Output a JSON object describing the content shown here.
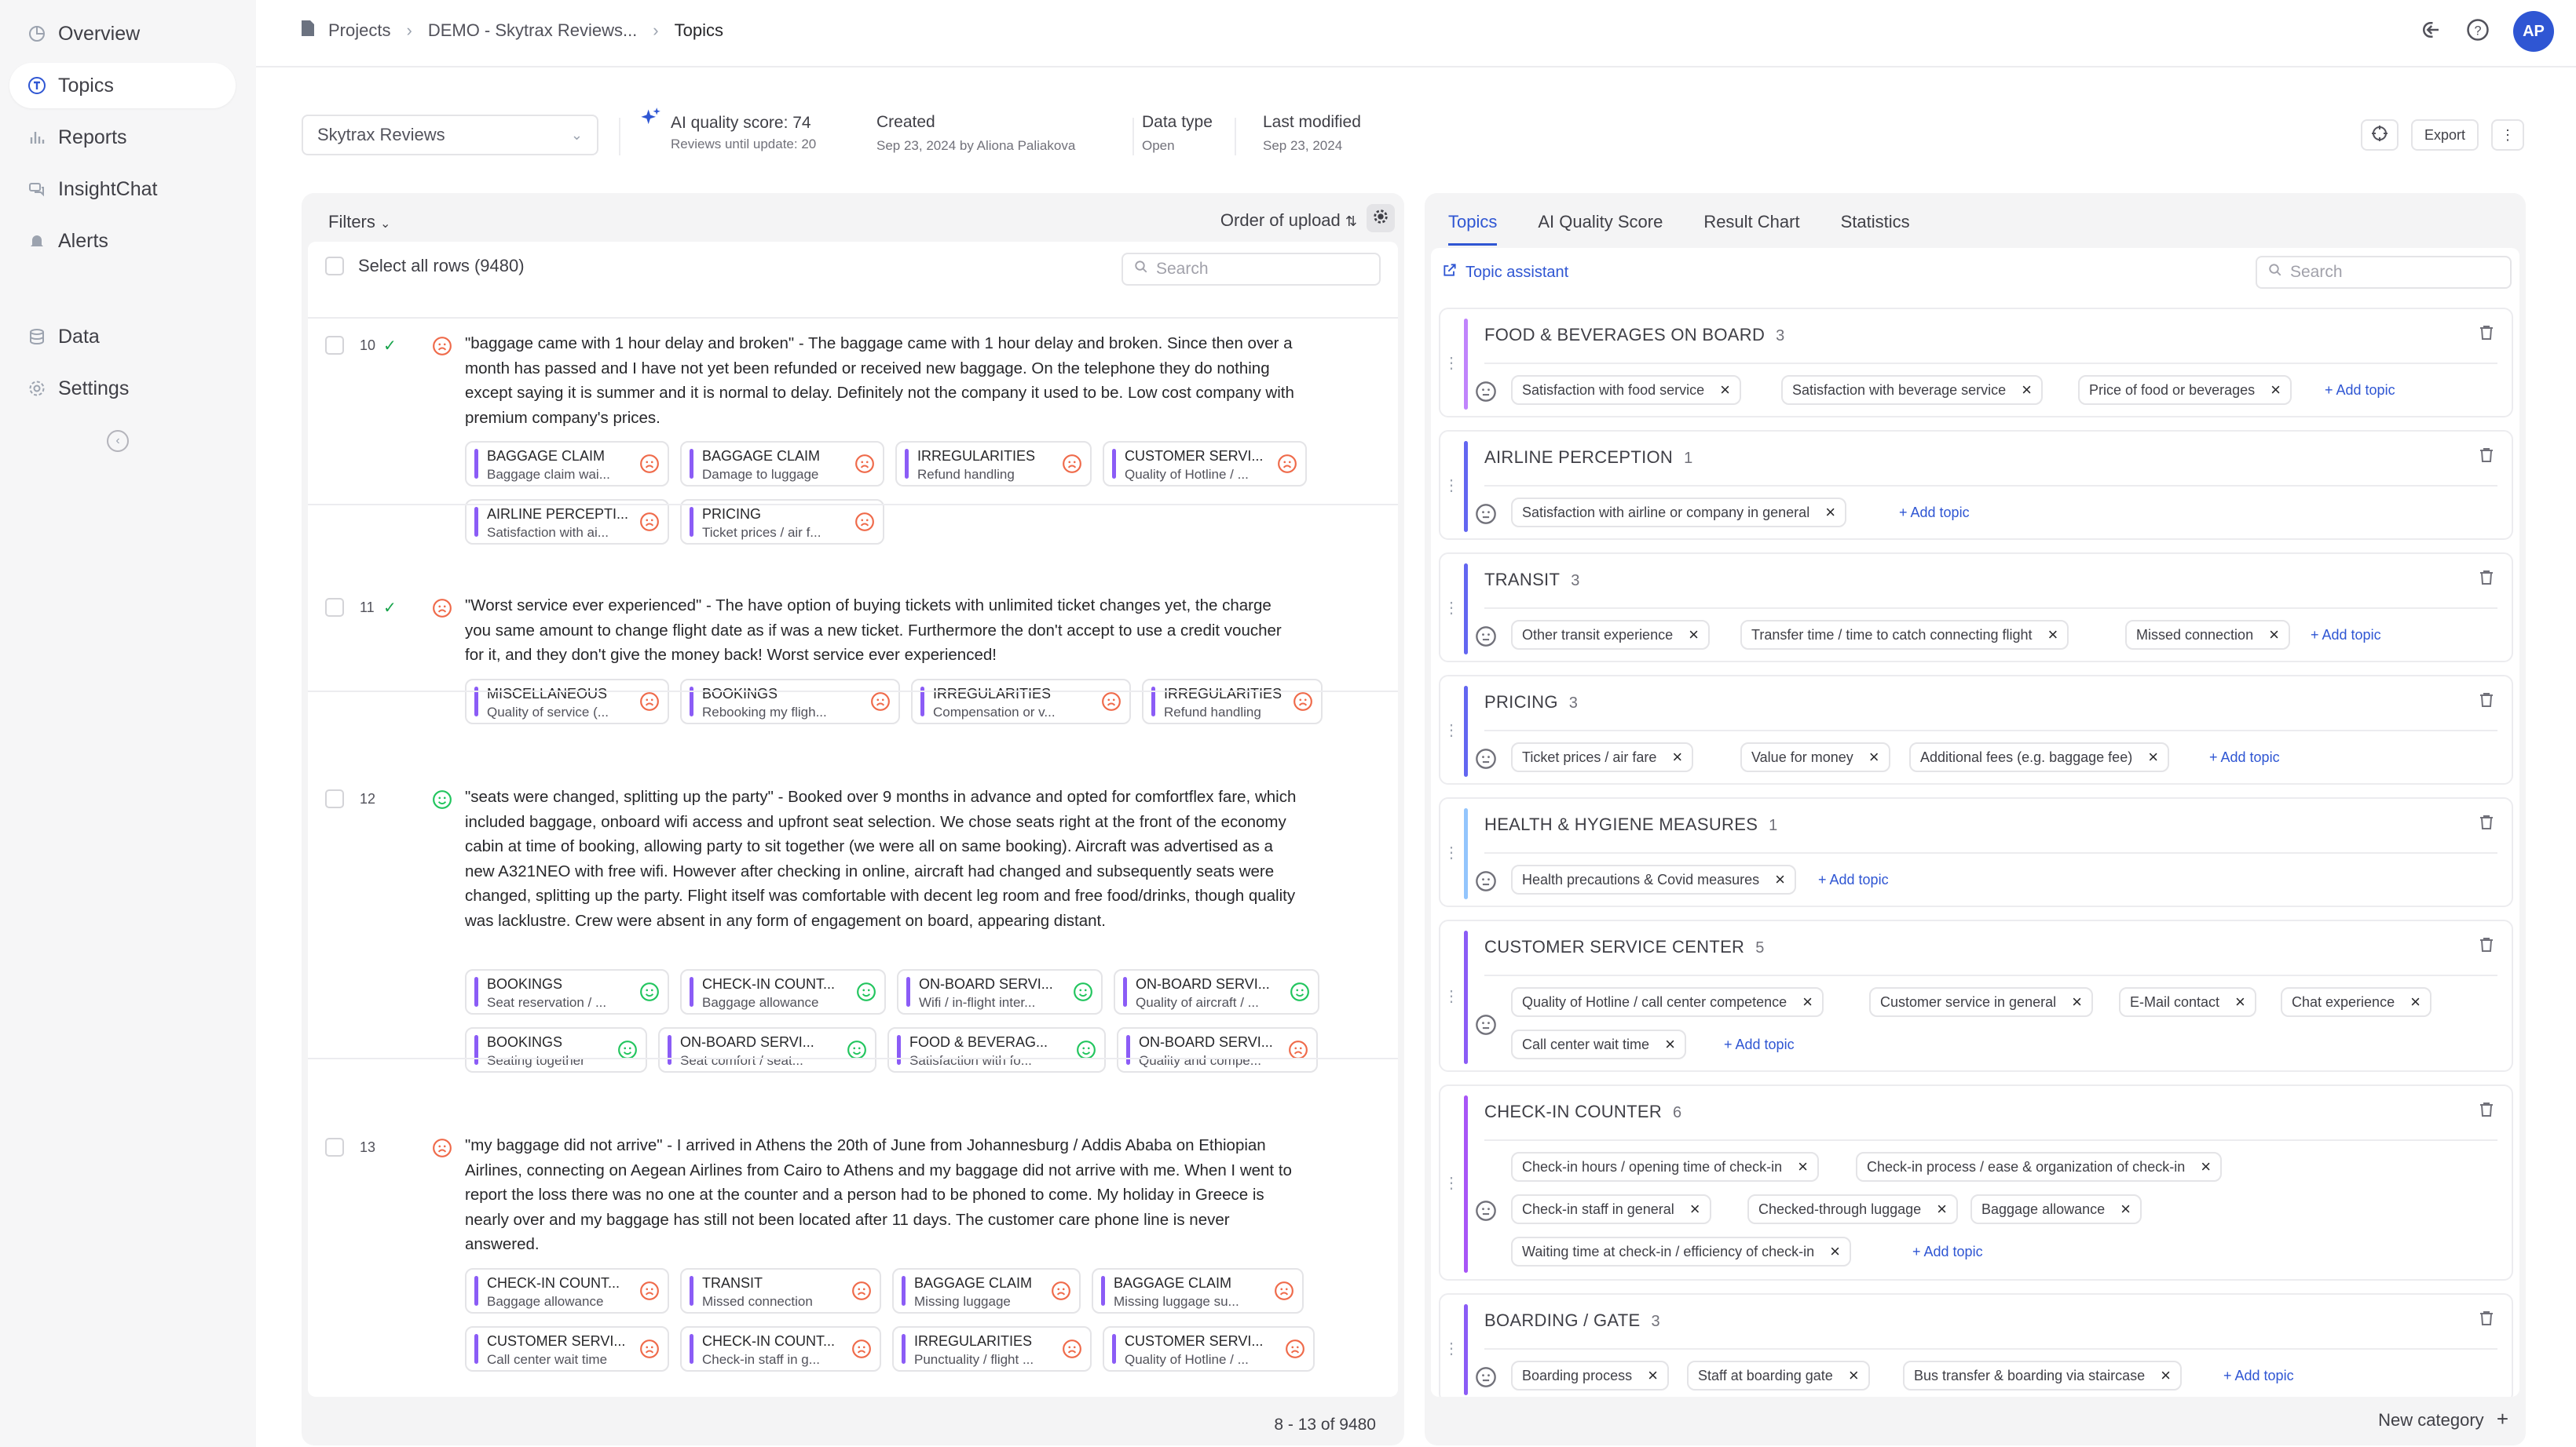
{
  "sidebar": {
    "items": [
      {
        "label": "Overview",
        "icon": "chart-pie-icon"
      },
      {
        "label": "Topics",
        "icon": "topic-icon"
      },
      {
        "label": "Reports",
        "icon": "bar-chart-icon"
      },
      {
        "label": "InsightChat",
        "icon": "chat-icon"
      },
      {
        "label": "Alerts",
        "icon": "bell-icon"
      },
      {
        "label": "Data",
        "icon": "database-icon"
      },
      {
        "label": "Settings",
        "icon": "gear-icon"
      }
    ]
  },
  "breadcrumb": {
    "root": "Projects",
    "project": "DEMO - Skytrax Reviews...",
    "current": "Topics"
  },
  "user": {
    "initials": "AP"
  },
  "info": {
    "dataset": "Skytrax Reviews",
    "quality_label": "AI quality score: 74",
    "quality_sub": "Reviews until update: 20",
    "created_label": "Created",
    "created_value": "Sep 23, 2024 by Aliona Paliakova",
    "datatype_label": "Data type",
    "datatype_value": "Open",
    "modified_label": "Last modified",
    "modified_value": "Sep 23, 2024",
    "export_label": "Export"
  },
  "left": {
    "filters": "Filters",
    "order": "Order of upload",
    "select_all": "Select all rows (9480)",
    "search_placeholder": "Search",
    "pager": "8 - 13 of 9480"
  },
  "reviews": [
    {
      "num": "10",
      "sentiment": "negative",
      "text": "\"baggage came with 1 hour delay and broken\" - The baggage came with 1 hour delay and broken. Since then over a month has passed and I have not yet been refunded or received new baggage. On the telephone they do nothing except saying it is summer and it is normal to delay. Definitely not the company it used to be. Low cost company with premium company's prices.",
      "tags": [
        {
          "cat": "BAGGAGE CLAIM",
          "topic": "Baggage claim wai...",
          "s": "neg"
        },
        {
          "cat": "BAGGAGE CLAIM",
          "topic": "Damage to luggage",
          "s": "neg"
        },
        {
          "cat": "IRREGULARITIES",
          "topic": "Refund handling",
          "s": "neg"
        },
        {
          "cat": "CUSTOMER SERVI...",
          "topic": "Quality of Hotline / ...",
          "s": "neg"
        },
        {
          "cat": "AIRLINE PERCEPTI...",
          "topic": "Satisfaction with ai...",
          "s": "neg"
        },
        {
          "cat": "PRICING",
          "topic": "Ticket prices / air f...",
          "s": "neg"
        }
      ]
    },
    {
      "num": "11",
      "sentiment": "negative",
      "text": "\"Worst service ever experienced\" - The have option of buying tickets with unlimited ticket changes yet, the charge you same amount to change flight date as if was a new ticket. Furthermore the don't accept to use a credit voucher for it, and they don't give the money back! Worst service ever experienced!",
      "tags": [
        {
          "cat": "MISCELLANEOUS",
          "topic": "Quality of service (...",
          "s": "neg"
        },
        {
          "cat": "BOOKINGS",
          "topic": "Rebooking my fligh...",
          "s": "neg"
        },
        {
          "cat": "IRREGULARITIES",
          "topic": "Compensation or v...",
          "s": "neg"
        },
        {
          "cat": "IRREGULARITIES",
          "topic": "Refund handling",
          "s": "neg"
        }
      ]
    },
    {
      "num": "12",
      "sentiment": "positive",
      "text": "\"seats were changed, splitting up the party\" - Booked over 9 months in advance and opted for comfortflex fare, which included baggage, onboard wifi access and upfront seat selection. We chose seats right at the front of the economy cabin at time of booking, allowing party to sit together (we were all on same booking). Aircraft was advertised as a new A321NEO with free wifi. However after checking in online, aircraft had changed and subsequently seats were changed, splitting up the party. Flight itself was comfortable with decent leg room and free food/drinks, though quality was lacklustre. Crew were absent in any form of engagement on board, appearing distant.",
      "tags": [
        {
          "cat": "BOOKINGS",
          "topic": "Seat reservation / ...",
          "s": "pos"
        },
        {
          "cat": "CHECK-IN COUNT...",
          "topic": "Baggage allowance",
          "s": "pos"
        },
        {
          "cat": "ON-BOARD SERVI...",
          "topic": "Wifi / in-flight inter...",
          "s": "pos"
        },
        {
          "cat": "ON-BOARD SERVI...",
          "topic": "Quality of aircraft / ...",
          "s": "pos"
        },
        {
          "cat": "BOOKINGS",
          "topic": "Seating together",
          "s": "pos"
        },
        {
          "cat": "ON-BOARD SERVI...",
          "topic": "Seat comfort / seat...",
          "s": "pos"
        },
        {
          "cat": "FOOD & BEVERAG...",
          "topic": "Satisfaction with fo...",
          "s": "pos"
        },
        {
          "cat": "ON-BOARD SERVI...",
          "topic": "Quality and compe...",
          "s": "neg"
        }
      ]
    },
    {
      "num": "13",
      "sentiment": "negative",
      "text": "\"my baggage did not arrive\" - I arrived in Athens the 20th of June from Johannesburg / Addis Ababa on Ethiopian Airlines, connecting on Aegean Airlines from Cairo to Athens and my baggage did not arrive with me. When I went to report the loss there was no one at the counter and a person had to be phoned to come. My holiday in Greece is nearly over and my baggage has still not been located after 11 days. The customer care phone line is never answered.",
      "tags": [
        {
          "cat": "CHECK-IN COUNT...",
          "topic": "Baggage allowance",
          "s": "neg"
        },
        {
          "cat": "TRANSIT",
          "topic": "Missed connection",
          "s": "neg"
        },
        {
          "cat": "BAGGAGE CLAIM",
          "topic": "Missing luggage",
          "s": "neg"
        },
        {
          "cat": "BAGGAGE CLAIM",
          "topic": "Missing luggage su...",
          "s": "neg"
        },
        {
          "cat": "CUSTOMER SERVI...",
          "topic": "Call center wait time",
          "s": "neg"
        },
        {
          "cat": "CHECK-IN COUNT...",
          "topic": "Check-in staff in g...",
          "s": "neg"
        },
        {
          "cat": "IRREGULARITIES",
          "topic": "Punctuality / flight ...",
          "s": "neg"
        },
        {
          "cat": "CUSTOMER SERVI...",
          "topic": "Quality of Hotline / ...",
          "s": "neg"
        }
      ]
    }
  ],
  "right": {
    "tabs": [
      "Topics",
      "AI Quality Score",
      "Result Chart",
      "Statistics"
    ],
    "assistant": "Topic assistant",
    "search_placeholder": "Search",
    "add_topic": "+ Add topic",
    "new_category": "New category"
  },
  "categories": [
    {
      "name": "FOOD & BEVERAGES ON BOARD",
      "count": "3",
      "color": "#c084fc",
      "rows": [
        [
          "Satisfaction with food service",
          "Satisfaction with beverage service",
          "Price of food or beverages"
        ]
      ]
    },
    {
      "name": "AIRLINE PERCEPTION",
      "count": "1",
      "color": "#6366f1",
      "rows": [
        [
          "Satisfaction with airline or company in general"
        ]
      ]
    },
    {
      "name": "TRANSIT",
      "count": "3",
      "color": "#6366f1",
      "rows": [
        [
          "Other transit experience",
          "Transfer time / time to catch connecting flight",
          "Missed connection"
        ]
      ]
    },
    {
      "name": "PRICING",
      "count": "3",
      "color": "#6366f1",
      "rows": [
        [
          "Ticket prices / air fare",
          "Value for money",
          "Additional fees (e.g. baggage fee)"
        ]
      ]
    },
    {
      "name": "HEALTH & HYGIENE MEASURES",
      "count": "1",
      "color": "#93c5fd",
      "rows": [
        [
          "Health precautions & Covid measures"
        ]
      ]
    },
    {
      "name": "CUSTOMER SERVICE CENTER",
      "count": "5",
      "color": "#8b5cf6",
      "rows": [
        [
          "Quality of Hotline / call center competence",
          "Customer service in general",
          "E-Mail contact",
          "Chat experience"
        ],
        [
          "Call center wait time"
        ]
      ]
    },
    {
      "name": "CHECK-IN COUNTER",
      "count": "6",
      "color": "#a855f7",
      "rows": [
        [
          "Check-in hours / opening time of check-in",
          "Check-in process / ease & organization of check-in"
        ],
        [
          "Check-in staff in general",
          "Checked-through luggage",
          "Baggage allowance"
        ],
        [
          "Waiting time at check-in / efficiency of check-in"
        ]
      ]
    },
    {
      "name": "BOARDING / GATE",
      "count": "3",
      "color": "#8b5cf6",
      "rows": [
        [
          "Boarding process",
          "Staff at boarding gate",
          "Bus transfer & boarding via staircase"
        ]
      ]
    }
  ]
}
